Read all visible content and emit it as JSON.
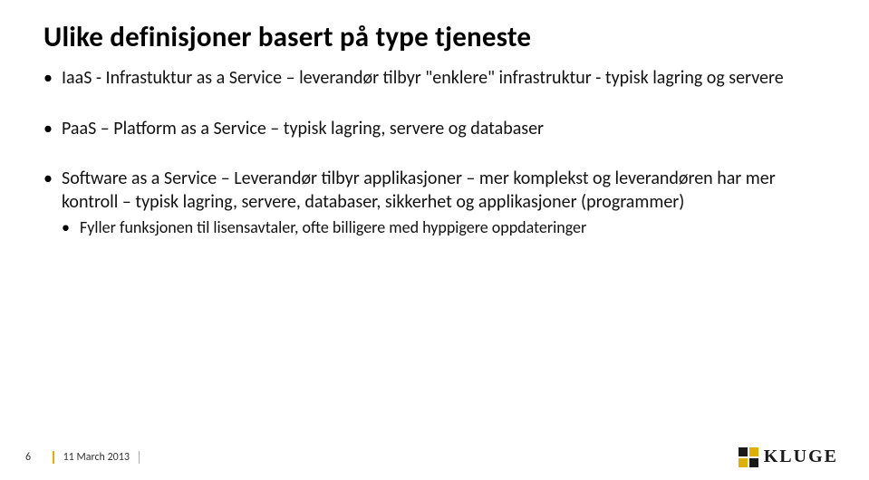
{
  "title": "Ulike definisjoner basert på type tjeneste",
  "bullets": [
    {
      "text": "IaaS - Infrastuktur as a Service – leverandør tilbyr \"enklere\" infrastruktur - typisk lagring og servere"
    },
    {
      "text": "PaaS – Platform as a Service – typisk lagring, servere og databaser"
    },
    {
      "text": "Software as a Service – Leverandør tilbyr applikasjoner – mer komplekst og leverandøren har mer kontroll – typisk lagring, servere, databaser, sikkerhet og applikasjoner (programmer)",
      "sub": [
        {
          "text": "Fyller funksjonen til lisensavtaler, ofte billigere med hyppigere oppdateringer"
        }
      ]
    }
  ],
  "footer": {
    "page": "6",
    "date": "11 March 2013"
  },
  "logo": "KLUGE"
}
